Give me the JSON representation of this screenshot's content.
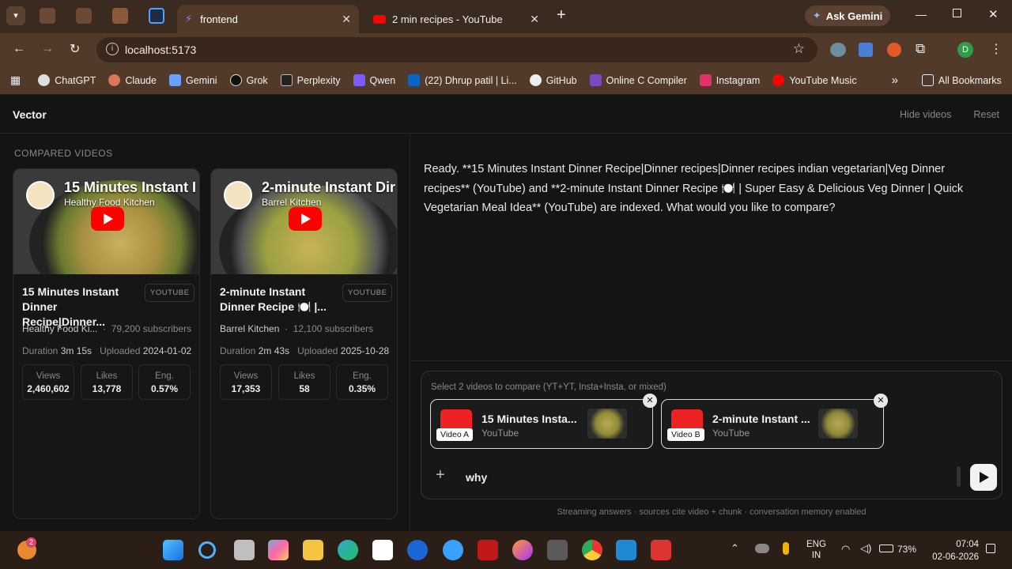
{
  "browser": {
    "tabs": [
      {
        "label": "frontend",
        "active": true
      },
      {
        "label": "2 min recipes - YouTube",
        "active": false
      }
    ],
    "ask_gemini": "Ask Gemini",
    "url": "localhost:5173",
    "profile_initial": "D",
    "bookmarks": [
      "ChatGPT",
      "Claude",
      "Gemini",
      "Grok",
      "Perplexity",
      "Qwen",
      "(22) Dhrup patil | Li...",
      "GitHub",
      "Online C Compiler",
      "Instagram",
      "YouTube Music"
    ],
    "all_bookmarks": "All Bookmarks",
    "overflow": "»"
  },
  "app": {
    "brand": "Vector",
    "hide_videos": "Hide videos",
    "reset": "Reset",
    "section_label": "COMPARED VIDEOS",
    "videos": [
      {
        "thumb_title": "15 Minutes Instant I",
        "thumb_channel": "Healthy Food Kitchen",
        "title_line1": "15 Minutes Instant",
        "title_line2": "Dinner Recipe|Dinner...",
        "platform": "YOUTUBE",
        "channel": "Healthy Food Ki...",
        "subscribers": "79,200 subscribers",
        "duration_label": "Duration",
        "duration": "3m 15s",
        "uploaded_label": "Uploaded",
        "uploaded": "2024-01-02",
        "views_label": "Views",
        "views": "2,460,602",
        "likes_label": "Likes",
        "likes": "13,778",
        "eng_label": "Eng.",
        "eng": "0.57%"
      },
      {
        "thumb_title": "2-minute Instant Dir",
        "thumb_channel": "Barrel Kitchen",
        "title_line1": "2-minute Instant",
        "title_line2": "Dinner Recipe 🍽️ |...",
        "platform": "YOUTUBE",
        "channel": "Barrel Kitchen",
        "subscribers": "12,100 subscribers",
        "duration_label": "Duration",
        "duration": "2m 43s",
        "uploaded_label": "Uploaded",
        "uploaded": "2025-10-28",
        "views_label": "Views",
        "views": "17,353",
        "likes_label": "Likes",
        "likes": "58",
        "eng_label": "Eng.",
        "eng": "0.35%"
      }
    ],
    "message": "Ready. **15 Minutes Instant Dinner Recipe|Dinner recipes|Dinner recipes indian vegetarian|Veg Dinner recipes** (YouTube) and **2-minute Instant Dinner Recipe 🍽️ | Super Easy & Delicious Veg Dinner | Quick Vegetarian Meal Idea** (YouTube) are indexed. What would you like to compare?",
    "composer": {
      "hint": "Select 2 videos to compare (YT+YT, Insta+Insta, or mixed)",
      "chip_a": {
        "name": "15 Minutes Insta...",
        "source": "YouTube",
        "tag": "Video A"
      },
      "chip_b": {
        "name": "2-minute Instant ...",
        "source": "YouTube",
        "tag": "Video B"
      },
      "input_value": "why",
      "plus": "+"
    },
    "footer_note": "Streaming answers · sources cite video + chunk · conversation memory enabled"
  },
  "taskbar": {
    "notif_count": "2",
    "lang_line1": "ENG",
    "lang_line2": "IN",
    "battery": "73%",
    "time": "07:04",
    "date": "02-06-2026"
  }
}
